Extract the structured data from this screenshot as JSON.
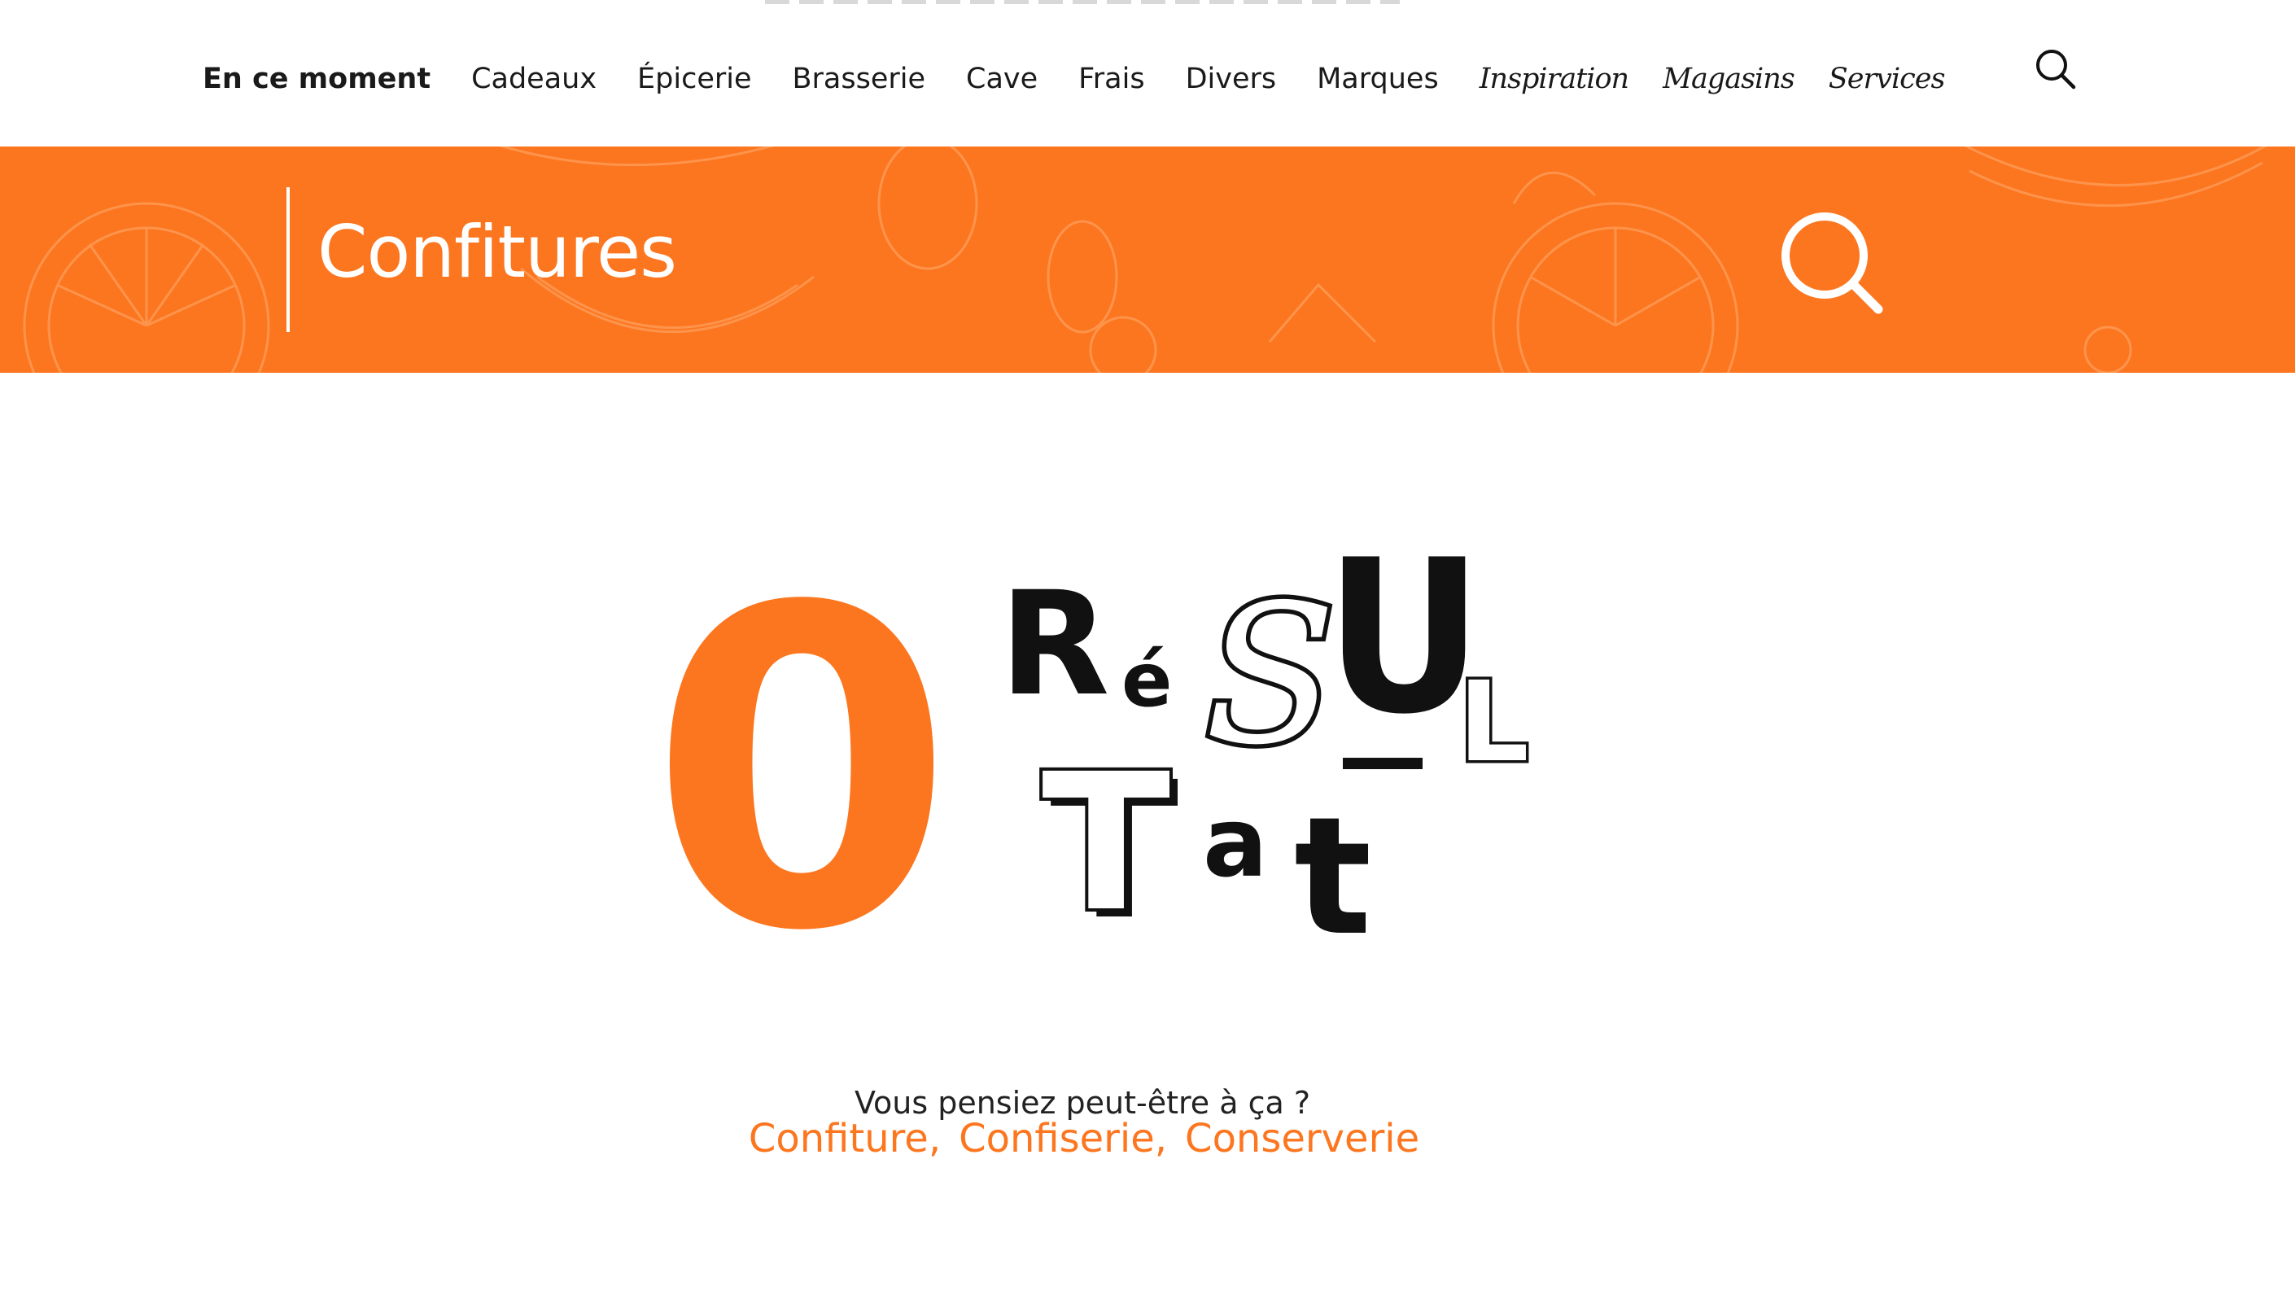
{
  "nav": {
    "items": [
      {
        "label": "En ce moment"
      },
      {
        "label": "Cadeaux"
      },
      {
        "label": "Épicerie"
      },
      {
        "label": "Brasserie"
      },
      {
        "label": "Cave"
      },
      {
        "label": "Frais"
      },
      {
        "label": "Divers"
      },
      {
        "label": "Marques"
      },
      {
        "label": "Inspiration"
      },
      {
        "label": "Magasins"
      },
      {
        "label": "Services"
      }
    ],
    "active_index": 0,
    "search_icon": "search-icon"
  },
  "banner": {
    "title": "Confitures",
    "search_icon": "search-icon",
    "background_color": "#fc761f",
    "pattern": "citrus-fruit-outlines"
  },
  "result": {
    "count": "0",
    "word_letters": {
      "R": "R",
      "e": "é",
      "S": "S",
      "U": "U",
      "L": "L",
      "T": "T",
      "a": "a",
      "t": "t"
    }
  },
  "suggestions": {
    "question": "Vous pensiez peut-être à ça ?",
    "items": [
      "Confiture",
      "Confiserie",
      "Conserverie"
    ],
    "separator": ","
  },
  "colors": {
    "accent": "#fc761f",
    "text": "#111111",
    "background": "#ffffff"
  }
}
